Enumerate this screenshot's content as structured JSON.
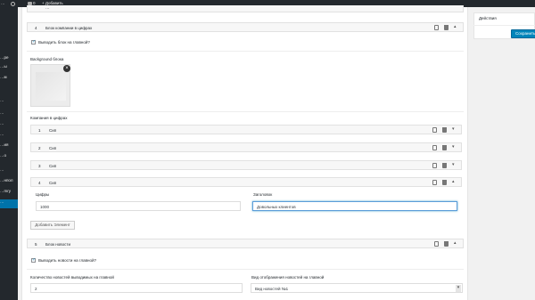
{
  "adminbar": {
    "site_label": "…",
    "comments_count": "0",
    "new_label": "Добавить"
  },
  "adminmenu": {
    "items": [
      "…pe",
      "…ы",
      "…м",
      "…",
      "…",
      "…",
      "…",
      "…ия",
      "…о",
      "…",
      "…нпол",
      "…mry",
      "…"
    ]
  },
  "block_top": {
    "label": "…"
  },
  "block_clients": {
    "number": "4",
    "title": "Блок компании в цифрах",
    "show_label": "Выводить блок на главной?",
    "bg_label": "Background блока"
  },
  "companies": {
    "title": "Компания в цифрах",
    "rows": [
      {
        "number": "1",
        "label": "Сип"
      },
      {
        "number": "2",
        "label": "Сип"
      },
      {
        "number": "3",
        "label": "Сип"
      },
      {
        "number": "4",
        "label": "Сип"
      }
    ],
    "digits_label": "Цифры",
    "digits_value": "1000",
    "heading_label": "Заголовок",
    "heading_value": "Довольных клиентов",
    "add_button": "Добавить Элемент"
  },
  "block_news": {
    "number": "5",
    "title": "Блок новости",
    "show_label": "Выводить новости на главной?",
    "count_label": "Количество новостей выводимых на главной",
    "count_value": "2",
    "view_label": "Вид отображения новостей на главной",
    "view_value": "Вид новостей №1"
  },
  "sidebar": {
    "title": "Действия",
    "save_button": "Сохранить"
  }
}
